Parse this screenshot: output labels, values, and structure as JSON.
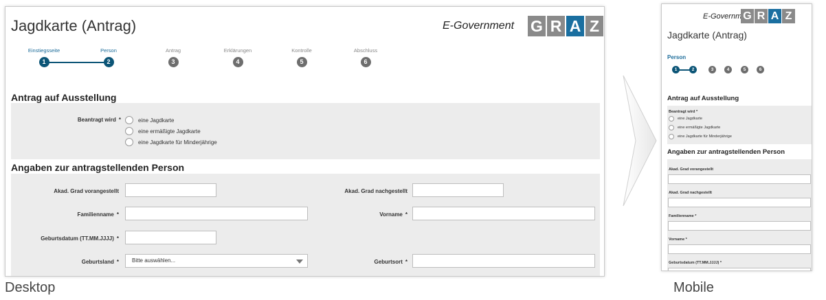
{
  "desktop": {
    "caption": "Desktop",
    "title": "Jagdkarte (Antrag)",
    "egov": "E-Government",
    "logo_letters": [
      "G",
      "R",
      "A",
      "Z"
    ],
    "steps": [
      {
        "label": "Einstiegsseite",
        "num": "1",
        "active": true
      },
      {
        "label": "Person",
        "num": "2",
        "active": true
      },
      {
        "label": "Antrag",
        "num": "3",
        "active": false
      },
      {
        "label": "Erklärungen",
        "num": "4",
        "active": false
      },
      {
        "label": "Kontrolle",
        "num": "5",
        "active": false
      },
      {
        "label": "Abschluss",
        "num": "6",
        "active": false
      }
    ],
    "section1": {
      "title": "Antrag auf Ausstellung",
      "field_label": "Beantragt wird",
      "required_mark": "*",
      "options": [
        "eine Jagdkarte",
        "eine ermäßigte Jagdkarte",
        "eine Jagdkarte für Minderjährige"
      ]
    },
    "section2": {
      "title": "Angaben zur antragstellenden Person",
      "fields": {
        "akad_vor": "Akad. Grad vorangestellt",
        "akad_nach": "Akad. Grad nachgestellt",
        "familienname": "Familienname",
        "vorname": "Vorname",
        "geburtsdatum": "Geburtsdatum (TT.MM.JJJJ)",
        "geburtsland": "Geburtsland",
        "geburtsort": "Geburtsort"
      },
      "required_mark": "*",
      "geburtsland_value": "Bitte auswählen..."
    }
  },
  "mobile": {
    "caption": "Mobile",
    "title": "Jagdkarte (Antrag)",
    "egov": "E-Government",
    "logo_letters": [
      "G",
      "R",
      "A",
      "Z"
    ],
    "current_step": "Person",
    "step_numbers": [
      "1",
      "2",
      "3",
      "4",
      "5",
      "6"
    ],
    "section1_title": "Antrag auf Ausstellung",
    "field_label": "Beantragt wird",
    "required_mark": "*",
    "options": [
      "eine Jagdkarte",
      "eine ermäßigte Jagdkarte",
      "eine Jagdkarte für Minderjährige"
    ],
    "section2_title": "Angaben zur antragstellenden Person",
    "fields": {
      "akad_vor": "Akad. Grad vorangestellt",
      "akad_nach": "Akad. Grad nachgestellt",
      "familienname": "Familienname",
      "vorname": "Vorname",
      "geburtsdatum": "Geburtsdatum (TT.MM.JJJJ)"
    }
  },
  "colors": {
    "accent": "#0c5577",
    "logo_highlight": "#1a6fa0",
    "panel_bg": "#ececec",
    "step_inactive": "#6e6e6e"
  }
}
